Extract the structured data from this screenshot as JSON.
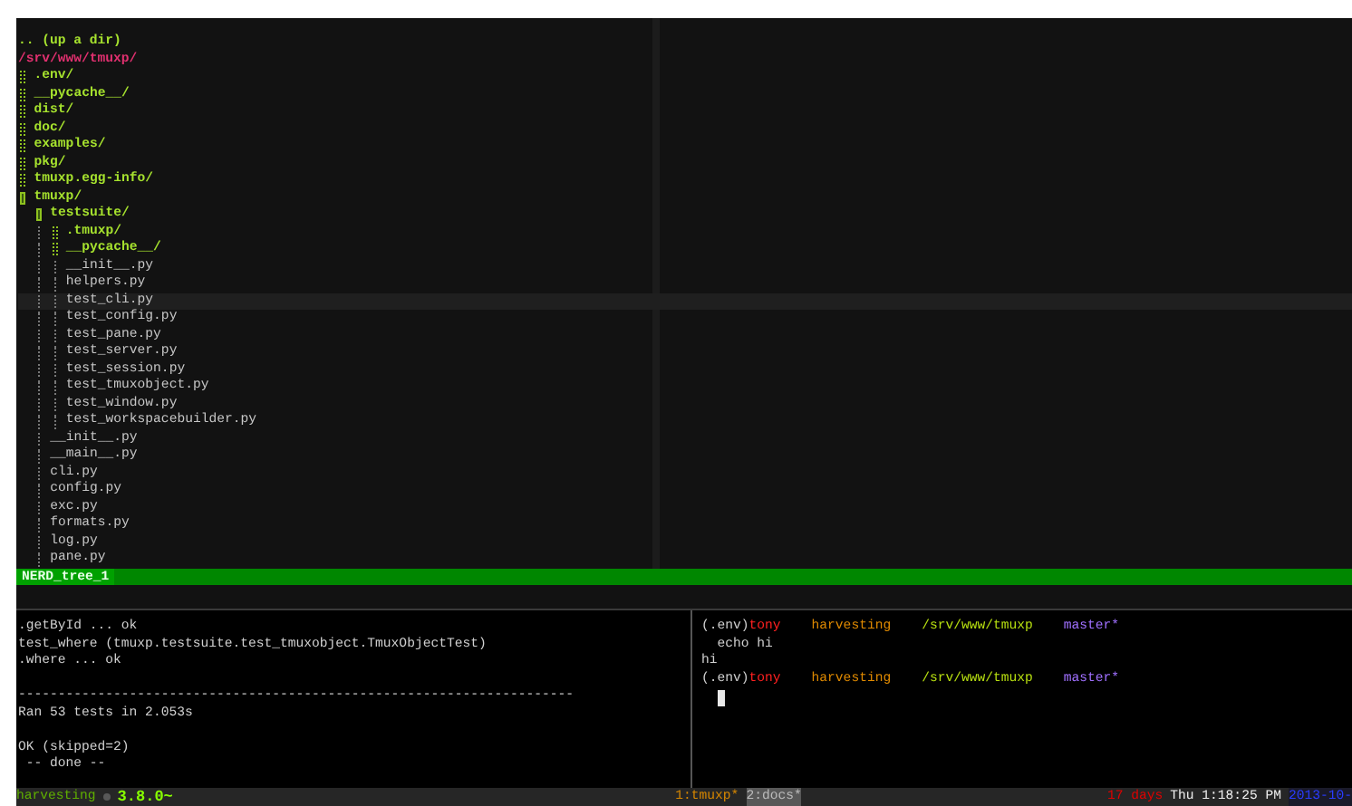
{
  "nerdtree": {
    "up_dir": ".. (up a dir)",
    "root": "/srv/www/tmuxp/",
    "items": [
      {
        "kind": "dir",
        "name": ".env/",
        "expanded": false,
        "selected": false
      },
      {
        "kind": "dir",
        "name": "__pycache__/",
        "expanded": false,
        "selected": false
      },
      {
        "kind": "dir",
        "name": "dist/",
        "expanded": false,
        "selected": false
      },
      {
        "kind": "dir",
        "name": "doc/",
        "expanded": false,
        "selected": false
      },
      {
        "kind": "dir",
        "name": "examples/",
        "expanded": false,
        "selected": false
      },
      {
        "kind": "dir",
        "name": "pkg/",
        "expanded": false,
        "selected": false
      },
      {
        "kind": "dir",
        "name": "tmuxp.egg-info/",
        "expanded": false,
        "selected": false
      },
      {
        "kind": "dir",
        "name": "tmuxp/",
        "expanded": true,
        "selected": false,
        "children": [
          {
            "kind": "dir",
            "name": "testsuite/",
            "expanded": true,
            "selected": false,
            "children": [
              {
                "kind": "dir",
                "name": ".tmuxp/",
                "expanded": false,
                "selected": false
              },
              {
                "kind": "dir",
                "name": "__pycache__/",
                "expanded": false,
                "selected": false
              },
              {
                "kind": "file",
                "name": "__init__.py",
                "selected": false
              },
              {
                "kind": "file",
                "name": "helpers.py",
                "selected": false
              },
              {
                "kind": "file",
                "name": "test_cli.py",
                "selected": true
              },
              {
                "kind": "file",
                "name": "test_config.py",
                "selected": false
              },
              {
                "kind": "file",
                "name": "test_pane.py",
                "selected": false
              },
              {
                "kind": "file",
                "name": "test_server.py",
                "selected": false
              },
              {
                "kind": "file",
                "name": "test_session.py",
                "selected": false
              },
              {
                "kind": "file",
                "name": "test_tmuxobject.py",
                "selected": false
              },
              {
                "kind": "file",
                "name": "test_window.py",
                "selected": false
              },
              {
                "kind": "file",
                "name": "test_workspacebuilder.py",
                "selected": false
              }
            ]
          },
          {
            "kind": "file",
            "name": "__init__.py",
            "selected": false
          },
          {
            "kind": "file",
            "name": "__main__.py",
            "selected": false
          },
          {
            "kind": "file",
            "name": "cli.py",
            "selected": false
          },
          {
            "kind": "file",
            "name": "config.py",
            "selected": false
          },
          {
            "kind": "file",
            "name": "exc.py",
            "selected": false
          },
          {
            "kind": "file",
            "name": "formats.py",
            "selected": false
          },
          {
            "kind": "file",
            "name": "log.py",
            "selected": false
          },
          {
            "kind": "file",
            "name": "pane.py",
            "selected": false
          }
        ]
      }
    ],
    "status_line": "NERD_tree_1"
  },
  "left_pane": {
    "lines": [
      {
        "kind": "text",
        "text": ".getById ... ok"
      },
      {
        "kind": "text",
        "text": "test_where (tmuxp.testsuite.test_tmuxobject.TmuxObjectTest)"
      },
      {
        "kind": "text",
        "text": ".where ... ok"
      },
      {
        "kind": "blank"
      },
      {
        "kind": "text",
        "text": "----------------------------------------------------------------------"
      },
      {
        "kind": "text",
        "text": "Ran 53 tests in 2.053s"
      },
      {
        "kind": "blank"
      },
      {
        "kind": "text",
        "text": "OK (skipped=2)"
      },
      {
        "kind": "text",
        "text": " -- done --"
      }
    ]
  },
  "right_pane": {
    "lines": [
      {
        "kind": "prompt",
        "segments": [
          {
            "kind": "env",
            "text": "(.env)"
          },
          {
            "kind": "user",
            "text": "tony"
          },
          {
            "kind": "host",
            "text": "harvesting"
          },
          {
            "kind": "path",
            "text": "/srv/www/tmuxp"
          },
          {
            "kind": "branch",
            "text": "master*"
          }
        ]
      },
      {
        "kind": "output",
        "text": "  echo hi"
      },
      {
        "kind": "output",
        "text": "hi"
      },
      {
        "kind": "prompt",
        "segments": [
          {
            "kind": "env",
            "text": "(.env)"
          },
          {
            "kind": "user",
            "text": "tony"
          },
          {
            "kind": "host",
            "text": "harvesting"
          },
          {
            "kind": "path",
            "text": "/srv/www/tmuxp"
          },
          {
            "kind": "branch",
            "text": "master*"
          }
        ]
      }
    ],
    "cursor": true
  },
  "status_bar": {
    "session": "harvesting",
    "version": "3.8.0~",
    "windows": [
      {
        "label": "1:tmuxp*",
        "selected": false
      },
      {
        "label": "2:docs*",
        "selected": true
      }
    ],
    "uptime": "17 days",
    "time": "Thu 1:18:25 PM",
    "date": "2013-10-"
  }
}
